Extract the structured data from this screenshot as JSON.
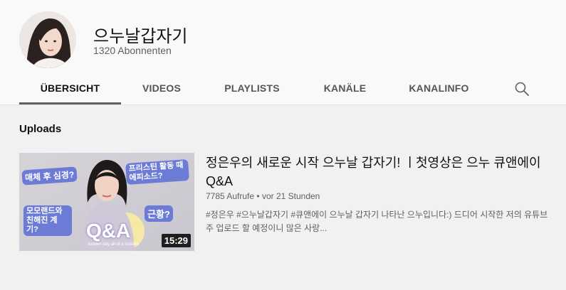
{
  "channel": {
    "name": "으누날갑자기",
    "subscribers": "1320 Abonnenten"
  },
  "tabs": [
    {
      "label": "ÜBERSICHT",
      "active": true
    },
    {
      "label": "VIDEOS",
      "active": false
    },
    {
      "label": "PLAYLISTS",
      "active": false
    },
    {
      "label": "KANÄLE",
      "active": false
    },
    {
      "label": "KANALINFO",
      "active": false
    }
  ],
  "search_icon": "search-icon",
  "uploads": {
    "title": "Uploads",
    "video": {
      "title_line1": "정은우의 새로운 시작 으누날 갑자기! ㅣ첫영상은 으누 큐앤에이",
      "title_line2": "Q&A",
      "views": "7785 Aufrufe",
      "separator": "•",
      "time": "vor 21 Stunden",
      "desc_line1": "#정은우 #으누날갑자기 #큐앤에이 으누날 갑자기 나타난 으누입니다:) 드디어 시작한 저의 유튜브",
      "desc_line2": "주 업로드 할 예정이니 많은 사랑...",
      "duration": "15:29",
      "thumbnail_text": {
        "left_top": "매체 후 심경?",
        "right_top": "프리스틴 활동 때\n에피소드?",
        "left_bottom": "모모랜드와\n친해진 계기?",
        "right_bottom": "근황?",
        "center": "Q&A",
        "small": "sudden day all of a sudden"
      }
    }
  },
  "colors": {
    "header_bg": "#f9f9f9",
    "page_bg": "#f1f1f1",
    "text_primary": "#0f0f0f",
    "text_secondary": "#606060"
  }
}
